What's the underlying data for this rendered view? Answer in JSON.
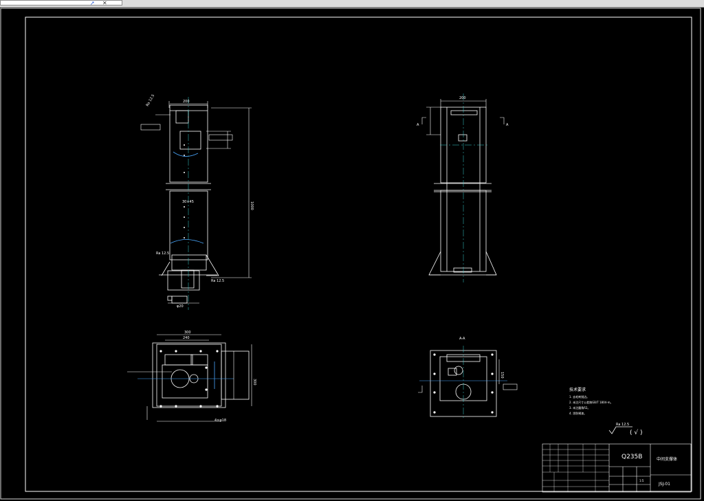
{
  "toolbar": {
    "icons": [
      "cursor-icon",
      "close-icon"
    ]
  },
  "drawing": {
    "roughness": "Ra 12.5",
    "roughness_other": "( √ )",
    "section_label": "A-A",
    "section_marks": [
      "A",
      "A"
    ],
    "tech_requirements": {
      "title": "技术要求",
      "items": [
        "1. 去毛刺锐边。",
        "2. 未注尺寸公差按GB/T 1804-m。",
        "3. 未注圆角R2。",
        "4. 涂防锈漆。"
      ]
    },
    "title_block": {
      "material": "Q235B",
      "part_name": "中间支撑体",
      "drawing_no": "JSJ-01",
      "scale": "1:5"
    },
    "dims": {
      "front_height": "1000",
      "front_width": "200",
      "side_width": "200",
      "plan_width": "300",
      "plan_inner": "240",
      "plan_height": "300",
      "hole_callout": "4×φ18",
      "section_dim": "150"
    }
  }
}
